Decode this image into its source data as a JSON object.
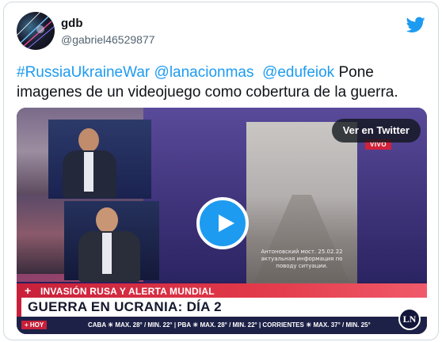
{
  "author": {
    "display_name": "gdb",
    "handle": "@gabriel46529877",
    "avatar_icon": "avatar-icon"
  },
  "brand_icon": "twitter-bird-icon",
  "tweet": {
    "hashtags": [
      "#RussiaUkraineWar"
    ],
    "mentions": [
      "@lanacionmas",
      "@edufeiok"
    ],
    "text_link_1": "#RussiaUkraineWar",
    "text_link_2": "@lanacionmas",
    "text_link_3": "@edufeiok",
    "text_body": "Pone imagenes de un videojuego como cobertura de la guerra."
  },
  "media": {
    "view_button_label": "Ver en Twitter",
    "play_icon": "play-icon",
    "video_caption": "Антоновский мост. 25.02.22 актуальная информация по поводу ситуации.",
    "live_badge": "VIVO",
    "lower_third_top": "INVASIÓN RUSA Y ALERTA MUNDIAL",
    "lower_third_main": "GUERRA EN UCRANIA: DÍA 2",
    "ticker_label": "+ HOY",
    "ticker_text": "CABA ☀ MAX. 28° / MIN. 22°  |  PBA ☀ MAX. 28° / MIN. 22°  |  CORRIENTES ☀ MAX. 37° / MIN. 25°",
    "channel_logo": "LN",
    "colors": {
      "link": "#1d9bf0",
      "play_button": "#1d9bf0",
      "lower_third_red": "#c8203a",
      "ticker_bg": "#1d2147"
    }
  }
}
